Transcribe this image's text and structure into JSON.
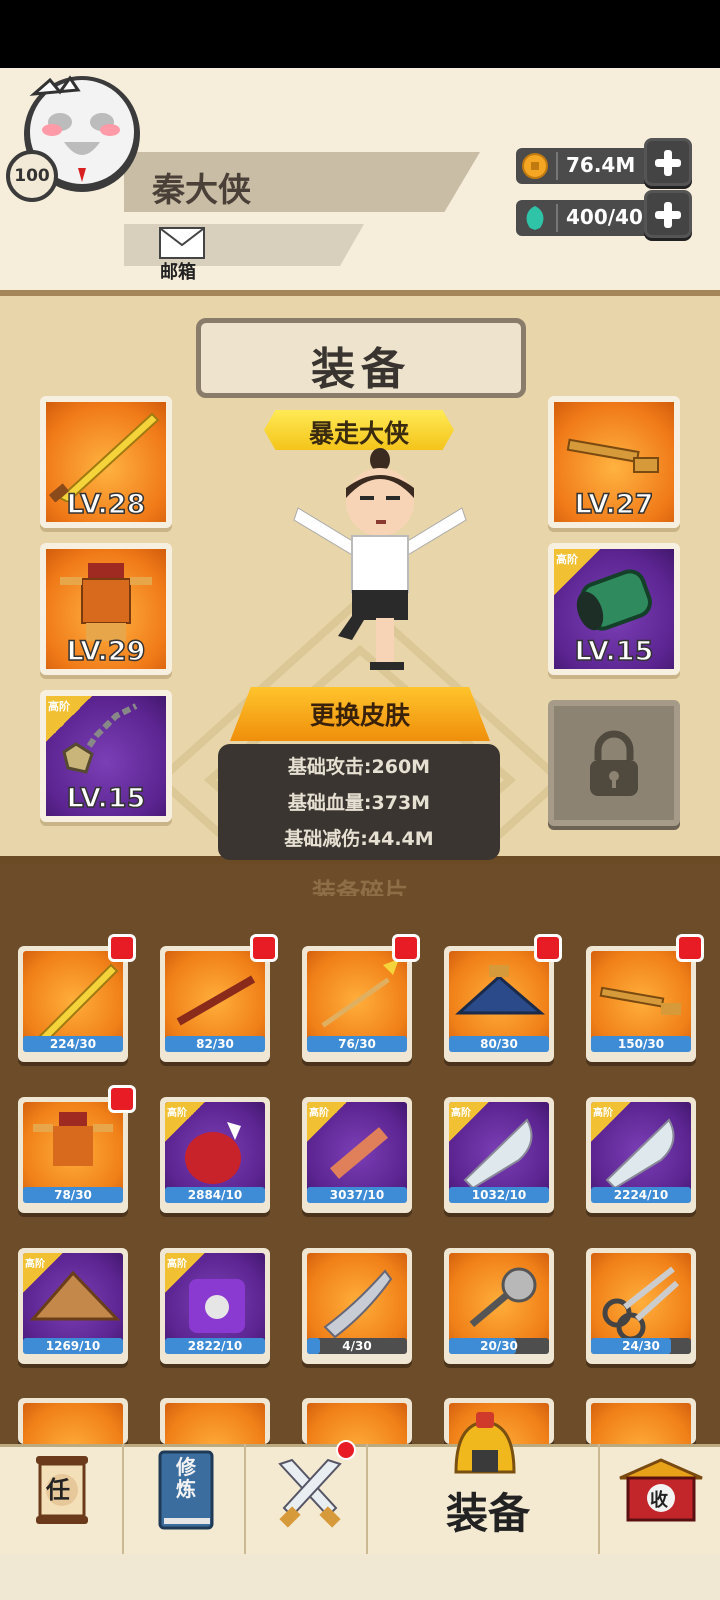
{
  "player": {
    "name": "秦大侠",
    "level": "100",
    "mail_label": "邮箱"
  },
  "currencies": {
    "coins": "76.4M",
    "energy": "400/40"
  },
  "equip_panel": {
    "title": "装备",
    "hero_title": "暴走大侠",
    "skin_button": "更换皮肤",
    "stats": [
      "基础攻击:260M",
      "基础血量:373M",
      "基础减伤:44.4M"
    ],
    "left_slots": [
      {
        "level": "LV.28",
        "item": "golden-sword",
        "rarity": "normal"
      },
      {
        "level": "LV.29",
        "item": "armor",
        "rarity": "normal"
      },
      {
        "level": "LV.15",
        "item": "pendant-necklace",
        "rarity": "advanced",
        "tag": "高阶"
      }
    ],
    "right_slots": [
      {
        "level": "LV.27",
        "item": "key",
        "rarity": "normal"
      },
      {
        "level": "LV.15",
        "item": "bracer",
        "rarity": "advanced",
        "tag": "高阶"
      }
    ]
  },
  "inventory": {
    "header": "装备碎片",
    "items": [
      {
        "count": "224/30",
        "item": "golden-sword",
        "rarity": "normal",
        "badge": true
      },
      {
        "count": "82/30",
        "item": "staff",
        "rarity": "normal",
        "badge": true
      },
      {
        "count": "76/30",
        "item": "spear",
        "rarity": "normal",
        "badge": true
      },
      {
        "count": "80/30",
        "item": "straw-hat",
        "rarity": "normal",
        "badge": true
      },
      {
        "count": "150/30",
        "item": "key",
        "rarity": "normal",
        "badge": true
      },
      {
        "count": "78/30",
        "item": "armor",
        "rarity": "normal",
        "badge": true
      },
      {
        "count": "2884/10",
        "item": "red-gauntlet",
        "rarity": "advanced",
        "tag": "高阶"
      },
      {
        "count": "3037/10",
        "item": "wooden-sword",
        "rarity": "advanced",
        "tag": "高阶"
      },
      {
        "count": "1032/10",
        "item": "broadsword",
        "rarity": "advanced",
        "tag": "高阶"
      },
      {
        "count": "2224/10",
        "item": "broadsword",
        "rarity": "advanced",
        "tag": "高阶"
      },
      {
        "count": "1269/10",
        "item": "bamboo-hat",
        "rarity": "advanced",
        "tag": "高阶"
      },
      {
        "count": "2822/10",
        "item": "purple-armor",
        "rarity": "advanced",
        "tag": "高阶"
      },
      {
        "count": "4/30",
        "item": "fish",
        "rarity": "normal",
        "progress": 0.13
      },
      {
        "count": "20/30",
        "item": "mace",
        "rarity": "normal",
        "progress": 0.67
      },
      {
        "count": "24/30",
        "item": "scissors",
        "rarity": "normal",
        "progress": 0.8
      }
    ]
  },
  "bottom_nav": {
    "tabs": [
      {
        "name": "task",
        "glyph": "任"
      },
      {
        "name": "cultivate",
        "glyph": "修炼"
      },
      {
        "name": "battle",
        "glyph": ""
      },
      {
        "name": "equipment",
        "label": "装备"
      },
      {
        "name": "collect",
        "glyph": "收"
      }
    ]
  },
  "colors": {
    "orange_slot": "#f07a18",
    "purple_slot": "#5b2490",
    "badge_red": "#e81c25",
    "count_blue": "#3e8bd6"
  }
}
